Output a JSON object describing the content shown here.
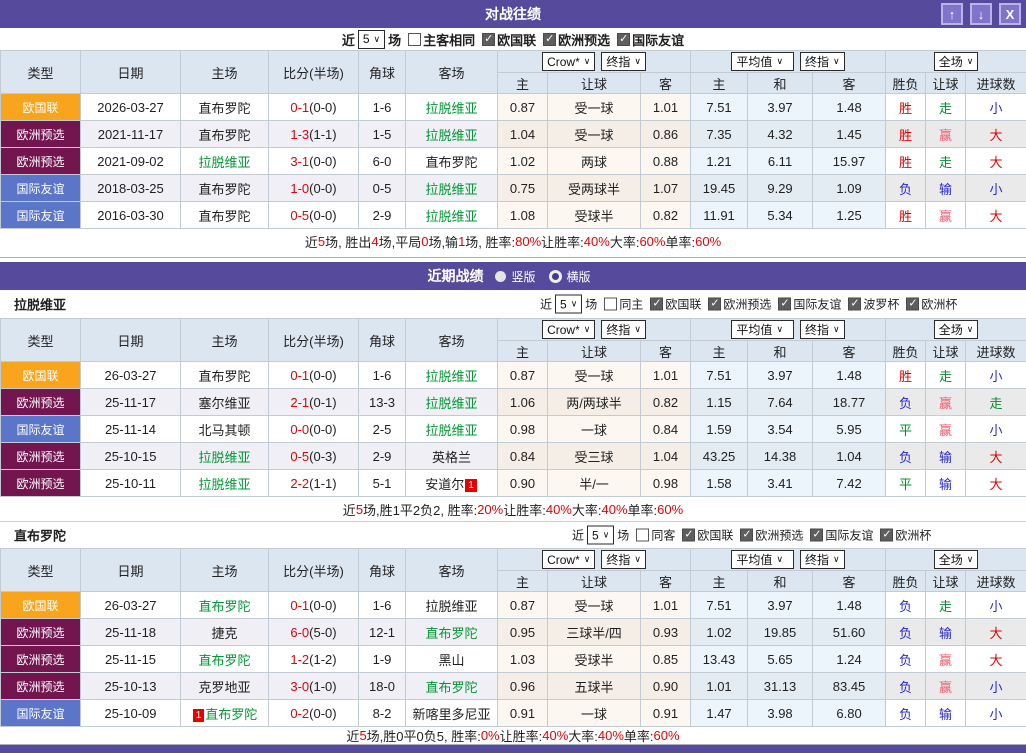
{
  "titlebar": {
    "title": "对战往绩",
    "up_glyph": "↑",
    "down_glyph": "↓",
    "close_glyph": "X"
  },
  "recent": {
    "title": "近期战绩",
    "radios": [
      {
        "label": "竖版",
        "selected": false
      },
      {
        "label": "横版",
        "selected": true
      }
    ]
  },
  "filter_labels": {
    "near": "近",
    "games": "场"
  },
  "selects": {
    "crow": "Crow*",
    "final": "终指",
    "avg": "平均值",
    "scope": "全场"
  },
  "head": {
    "cols": [
      "类型",
      "日期",
      "主场",
      "比分(半场)",
      "角球",
      "客场",
      "主",
      "让球",
      "客",
      "主",
      "和",
      "客",
      "胜负",
      "让球",
      "进球数"
    ]
  },
  "type_colors": {
    "欧国联": "#f8a41d",
    "欧洲预选": "#731650",
    "国际友谊": "#5b76c8"
  },
  "text_colors": {
    "red": "#e60000",
    "blue": "#2626d9",
    "green": "#008f2e",
    "pink": "#f25a6e"
  },
  "tables": [
    {
      "title": null,
      "count": "5",
      "checks": [
        {
          "label": "主客相同",
          "checked": false
        },
        {
          "label": "欧国联",
          "checked": true
        },
        {
          "label": "欧洲预选",
          "checked": true
        },
        {
          "label": "国际友谊",
          "checked": true
        }
      ],
      "rows": [
        {
          "type": "欧国联",
          "date": "2026-03-27",
          "home": "直布罗陀",
          "home_green": false,
          "home_badge": "",
          "score": "0-1",
          "half": "(0-0)",
          "corner": "1-6",
          "away": "拉脱维亚",
          "away_green": true,
          "away_badge": "",
          "odds": [
            "0.87",
            "受一球",
            "1.01",
            "7.51",
            "3.97",
            "1.48"
          ],
          "res": [
            [
              "胜",
              "red"
            ],
            [
              "走",
              "green"
            ],
            [
              "小",
              "blue"
            ]
          ]
        },
        {
          "type": "欧洲预选",
          "date": "2021-11-17",
          "home": "直布罗陀",
          "home_green": false,
          "home_badge": "",
          "score": "1-3",
          "half": "(1-1)",
          "corner": "1-5",
          "away": "拉脱维亚",
          "away_green": true,
          "away_badge": "",
          "odds": [
            "1.04",
            "受一球",
            "0.86",
            "7.35",
            "4.32",
            "1.45"
          ],
          "res": [
            [
              "胜",
              "red"
            ],
            [
              "赢",
              "pink"
            ],
            [
              "大",
              "red"
            ]
          ]
        },
        {
          "type": "欧洲预选",
          "date": "2021-09-02",
          "home": "拉脱维亚",
          "home_green": true,
          "home_badge": "",
          "score": "3-1",
          "half": "(0-0)",
          "corner": "6-0",
          "away": "直布罗陀",
          "away_green": false,
          "away_badge": "",
          "odds": [
            "1.02",
            "两球",
            "0.88",
            "1.21",
            "6.11",
            "15.97"
          ],
          "res": [
            [
              "胜",
              "red"
            ],
            [
              "走",
              "green"
            ],
            [
              "大",
              "red"
            ]
          ]
        },
        {
          "type": "国际友谊",
          "date": "2018-03-25",
          "home": "直布罗陀",
          "home_green": false,
          "home_badge": "",
          "score": "1-0",
          "half": "(0-0)",
          "corner": "0-5",
          "away": "拉脱维亚",
          "away_green": true,
          "away_badge": "",
          "odds": [
            "0.75",
            "受两球半",
            "1.07",
            "19.45",
            "9.29",
            "1.09"
          ],
          "res": [
            [
              "负",
              "blue"
            ],
            [
              "输",
              "blue"
            ],
            [
              "小",
              "blue"
            ]
          ]
        },
        {
          "type": "国际友谊",
          "date": "2016-03-30",
          "home": "直布罗陀",
          "home_green": false,
          "home_badge": "",
          "score": "0-5",
          "half": "(0-0)",
          "corner": "2-9",
          "away": "拉脱维亚",
          "away_green": true,
          "away_badge": "",
          "odds": [
            "1.08",
            "受球半",
            "0.82",
            "11.91",
            "5.34",
            "1.25"
          ],
          "res": [
            [
              "胜",
              "red"
            ],
            [
              "赢",
              "pink"
            ],
            [
              "大",
              "red"
            ]
          ]
        }
      ],
      "summary": [
        {
          "t": "近 ",
          "r": false
        },
        {
          "t": "5",
          "r": true
        },
        {
          "t": " 场, 胜出 ",
          "r": false
        },
        {
          "t": "4",
          "r": true
        },
        {
          "t": " 场,平局 ",
          "r": false
        },
        {
          "t": "0",
          "r": true
        },
        {
          "t": " 场,输 ",
          "r": false
        },
        {
          "t": "1",
          "r": true
        },
        {
          "t": " 场, 胜率: ",
          "r": false
        },
        {
          "t": "80%",
          "r": true
        },
        {
          "t": " 让胜率: ",
          "r": false
        },
        {
          "t": "40%",
          "r": true
        },
        {
          "t": " 大率: ",
          "r": false
        },
        {
          "t": "60%",
          "r": true
        },
        {
          "t": " 单率: ",
          "r": false
        },
        {
          "t": "60%",
          "r": true
        }
      ]
    },
    {
      "title": "拉脱维亚",
      "count": "5",
      "checks": [
        {
          "label": "同主",
          "checked": false
        },
        {
          "label": "欧国联",
          "checked": true
        },
        {
          "label": "欧洲预选",
          "checked": true
        },
        {
          "label": "国际友谊",
          "checked": true
        },
        {
          "label": "波罗杯",
          "checked": true
        },
        {
          "label": "欧洲杯",
          "checked": true
        }
      ],
      "rows": [
        {
          "type": "欧国联",
          "date": "26-03-27",
          "home": "直布罗陀",
          "home_green": false,
          "home_badge": "",
          "score": "0-1",
          "half": "(0-0)",
          "corner": "1-6",
          "away": "拉脱维亚",
          "away_green": true,
          "away_badge": "",
          "odds": [
            "0.87",
            "受一球",
            "1.01",
            "7.51",
            "3.97",
            "1.48"
          ],
          "res": [
            [
              "胜",
              "red"
            ],
            [
              "走",
              "green"
            ],
            [
              "小",
              "blue"
            ]
          ]
        },
        {
          "type": "欧洲预选",
          "date": "25-11-17",
          "home": "塞尔维亚",
          "home_green": false,
          "home_badge": "",
          "score": "2-1",
          "half": "(0-1)",
          "corner": "13-3",
          "away": "拉脱维亚",
          "away_green": true,
          "away_badge": "",
          "odds": [
            "1.06",
            "两/两球半",
            "0.82",
            "1.15",
            "7.64",
            "18.77"
          ],
          "res": [
            [
              "负",
              "blue"
            ],
            [
              "赢",
              "pink"
            ],
            [
              "走",
              "green"
            ]
          ]
        },
        {
          "type": "国际友谊",
          "date": "25-11-14",
          "home": "北马其顿",
          "home_green": false,
          "home_badge": "",
          "score": "0-0",
          "half": "(0-0)",
          "corner": "2-5",
          "away": "拉脱维亚",
          "away_green": true,
          "away_badge": "",
          "odds": [
            "0.98",
            "一球",
            "0.84",
            "1.59",
            "3.54",
            "5.95"
          ],
          "res": [
            [
              "平",
              "green"
            ],
            [
              "赢",
              "pink"
            ],
            [
              "小",
              "blue"
            ]
          ]
        },
        {
          "type": "欧洲预选",
          "date": "25-10-15",
          "home": "拉脱维亚",
          "home_green": true,
          "home_badge": "",
          "score": "0-5",
          "half": "(0-3)",
          "corner": "2-9",
          "away": "英格兰",
          "away_green": false,
          "away_badge": "",
          "odds": [
            "0.84",
            "受三球",
            "1.04",
            "43.25",
            "14.38",
            "1.04"
          ],
          "res": [
            [
              "负",
              "blue"
            ],
            [
              "输",
              "blue"
            ],
            [
              "大",
              "red"
            ]
          ]
        },
        {
          "type": "欧洲预选",
          "date": "25-10-11",
          "home": "拉脱维亚",
          "home_green": true,
          "home_badge": "",
          "score": "2-2",
          "half": "(1-1)",
          "corner": "5-1",
          "away": "安道尔",
          "away_green": false,
          "away_badge": "1",
          "odds": [
            "0.90",
            "半/一",
            "0.98",
            "1.58",
            "3.41",
            "7.42"
          ],
          "res": [
            [
              "平",
              "green"
            ],
            [
              "输",
              "blue"
            ],
            [
              "大",
              "red"
            ]
          ]
        }
      ],
      "summary": [
        {
          "t": "近",
          "r": false
        },
        {
          "t": "5",
          "r": true
        },
        {
          "t": "场,胜1平2负2, 胜率:",
          "r": false
        },
        {
          "t": "20%",
          "r": true
        },
        {
          "t": " 让胜率:",
          "r": false
        },
        {
          "t": "40%",
          "r": true
        },
        {
          "t": " 大率:",
          "r": false
        },
        {
          "t": "40%",
          "r": true
        },
        {
          "t": " 单率:",
          "r": false
        },
        {
          "t": "60%",
          "r": true
        }
      ]
    },
    {
      "title": "直布罗陀",
      "count": "5",
      "checks": [
        {
          "label": "同客",
          "checked": false
        },
        {
          "label": "欧国联",
          "checked": true
        },
        {
          "label": "欧洲预选",
          "checked": true
        },
        {
          "label": "国际友谊",
          "checked": true
        },
        {
          "label": "欧洲杯",
          "checked": true
        }
      ],
      "rows": [
        {
          "type": "欧国联",
          "date": "26-03-27",
          "home": "直布罗陀",
          "home_green": true,
          "home_badge": "",
          "score": "0-1",
          "half": "(0-0)",
          "corner": "1-6",
          "away": "拉脱维亚",
          "away_green": false,
          "away_badge": "",
          "odds": [
            "0.87",
            "受一球",
            "1.01",
            "7.51",
            "3.97",
            "1.48"
          ],
          "res": [
            [
              "负",
              "blue"
            ],
            [
              "走",
              "green"
            ],
            [
              "小",
              "blue"
            ]
          ]
        },
        {
          "type": "欧洲预选",
          "date": "25-11-18",
          "home": "捷克",
          "home_green": false,
          "home_badge": "",
          "score": "6-0",
          "half": "(5-0)",
          "corner": "12-1",
          "away": "直布罗陀",
          "away_green": true,
          "away_badge": "",
          "odds": [
            "0.95",
            "三球半/四",
            "0.93",
            "1.02",
            "19.85",
            "51.60"
          ],
          "res": [
            [
              "负",
              "blue"
            ],
            [
              "输",
              "blue"
            ],
            [
              "大",
              "red"
            ]
          ]
        },
        {
          "type": "欧洲预选",
          "date": "25-11-15",
          "home": "直布罗陀",
          "home_green": true,
          "home_badge": "",
          "score": "1-2",
          "half": "(1-2)",
          "corner": "1-9",
          "away": "黑山",
          "away_green": false,
          "away_badge": "",
          "odds": [
            "1.03",
            "受球半",
            "0.85",
            "13.43",
            "5.65",
            "1.24"
          ],
          "res": [
            [
              "负",
              "blue"
            ],
            [
              "赢",
              "pink"
            ],
            [
              "大",
              "red"
            ]
          ]
        },
        {
          "type": "欧洲预选",
          "date": "25-10-13",
          "home": "克罗地亚",
          "home_green": false,
          "home_badge": "",
          "score": "3-0",
          "half": "(1-0)",
          "corner": "18-0",
          "away": "直布罗陀",
          "away_green": true,
          "away_badge": "",
          "odds": [
            "0.96",
            "五球半",
            "0.90",
            "1.01",
            "31.13",
            "83.45"
          ],
          "res": [
            [
              "负",
              "blue"
            ],
            [
              "赢",
              "pink"
            ],
            [
              "小",
              "blue"
            ]
          ]
        },
        {
          "type": "国际友谊",
          "date": "25-10-09",
          "home": "直布罗陀",
          "home_green": true,
          "home_badge": "1",
          "score": "0-2",
          "half": "(0-0)",
          "corner": "8-2",
          "away": "新喀里多尼亚",
          "away_green": false,
          "away_badge": "",
          "odds": [
            "0.91",
            "一球",
            "0.91",
            "1.47",
            "3.98",
            "6.80"
          ],
          "res": [
            [
              "负",
              "blue"
            ],
            [
              "输",
              "blue"
            ],
            [
              "小",
              "blue"
            ]
          ]
        }
      ],
      "summary": [
        {
          "t": "近",
          "r": false
        },
        {
          "t": "5",
          "r": true
        },
        {
          "t": "场,胜0平0负5, 胜率:",
          "r": false
        },
        {
          "t": "0%",
          "r": true
        },
        {
          "t": " 让胜率:",
          "r": false
        },
        {
          "t": "40%",
          "r": true
        },
        {
          "t": " 大率:",
          "r": false
        },
        {
          "t": "40%",
          "r": true
        },
        {
          "t": " 单率:",
          "r": false
        },
        {
          "t": "60%",
          "r": true
        }
      ]
    }
  ]
}
